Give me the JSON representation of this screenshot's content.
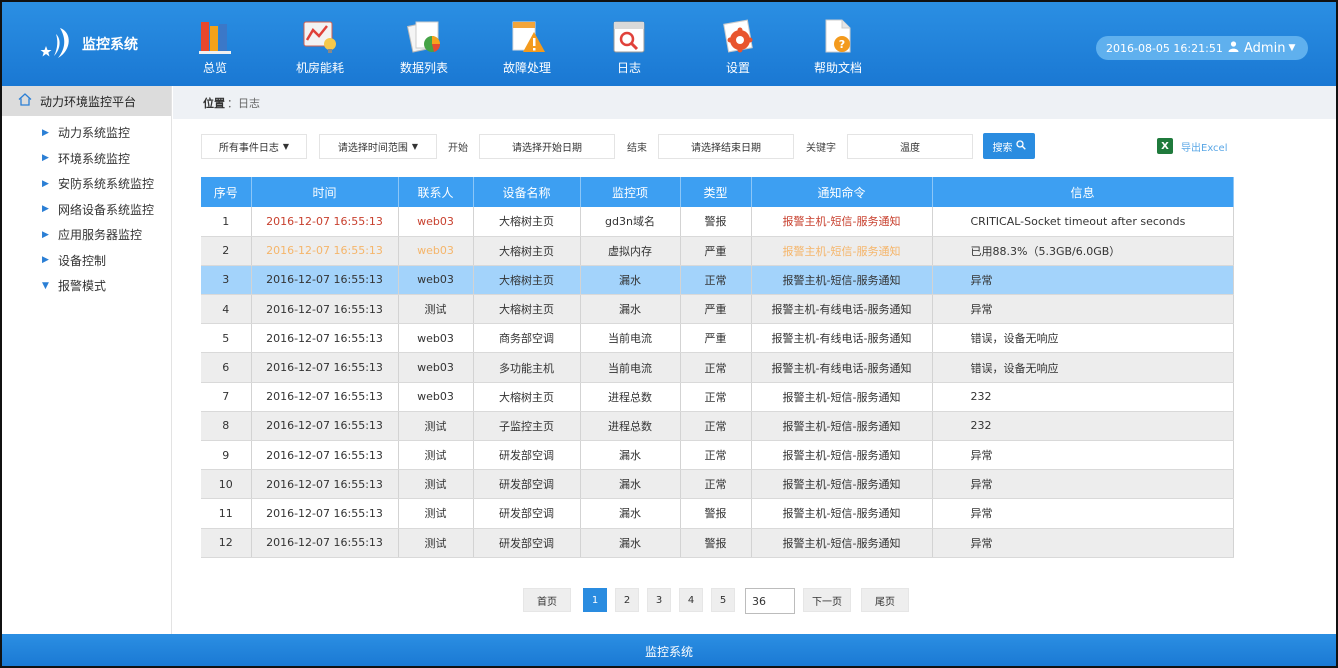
{
  "app": {
    "title": "监控系统"
  },
  "nav": [
    {
      "label": "总览",
      "icon": "books-icon"
    },
    {
      "label": "机房能耗",
      "icon": "energy-chart-icon"
    },
    {
      "label": "数据列表",
      "icon": "data-list-icon"
    },
    {
      "label": "故障处理",
      "icon": "warning-icon"
    },
    {
      "label": "日志",
      "icon": "log-calendar-icon"
    },
    {
      "label": "设置",
      "icon": "settings-gear-icon"
    },
    {
      "label": "帮助文档",
      "icon": "help-document-icon"
    }
  ],
  "header": {
    "datetime": "2016-08-05 16:21:51",
    "user": "Admin"
  },
  "sidebar": {
    "title": "动力环境监控平台",
    "items": [
      {
        "label": "动力系统监控",
        "expanded": false
      },
      {
        "label": "环境系统监控",
        "expanded": false
      },
      {
        "label": "安防系统系统监控",
        "expanded": false
      },
      {
        "label": "网络设备系统监控",
        "expanded": false
      },
      {
        "label": "应用服务器监控",
        "expanded": false
      },
      {
        "label": "设备控制",
        "expanded": false
      },
      {
        "label": "报警模式",
        "expanded": true
      }
    ]
  },
  "breadcrumb": {
    "prefix": "位置",
    "sep": "：",
    "current": "日志"
  },
  "filters": {
    "event_type": "所有事件日志",
    "time_range": "请选择时间范围",
    "start_label": "开始",
    "start_placeholder": "请选择开始日期",
    "end_label": "结束",
    "end_placeholder": "请选择结束日期",
    "keyword_label": "关键字",
    "keyword_value": "温度",
    "search_label": "搜索",
    "export_label": "导出Excel"
  },
  "table": {
    "columns": [
      "序号",
      "时间",
      "联系人",
      "设备名称",
      "监控项",
      "类型",
      "通知命令",
      "信息"
    ],
    "rows": [
      {
        "no": "1",
        "time": "2016-12-07 16:55:13",
        "contact": "web03",
        "device": "大榕树主页",
        "item": "gd3n域名",
        "type": "警报",
        "cmd": "报警主机-短信-服务通知",
        "info": "CRITICAL-Socket timeout after seconds",
        "tone": "red"
      },
      {
        "no": "2",
        "time": "2016-12-07 16:55:13",
        "contact": "web03",
        "device": "大榕树主页",
        "item": "虚拟内存",
        "type": "严重",
        "cmd": "报警主机-短信-服务通知",
        "info": "已用88.3%（5.3GB/6.0GB）",
        "tone": "orange"
      },
      {
        "no": "3",
        "time": "2016-12-07 16:55:13",
        "contact": "web03",
        "device": "大榕树主页",
        "item": "漏水",
        "type": "正常",
        "cmd": "报警主机-短信-服务通知",
        "info": "异常",
        "tone": "selected"
      },
      {
        "no": "4",
        "time": "2016-12-07 16:55:13",
        "contact": "测试",
        "device": "大榕树主页",
        "item": "漏水",
        "type": "严重",
        "cmd": "报警主机-有线电话-服务通知",
        "info": "异常",
        "tone": ""
      },
      {
        "no": "5",
        "time": "2016-12-07 16:55:13",
        "contact": "web03",
        "device": "商务部空调",
        "item": "当前电流",
        "type": "严重",
        "cmd": "报警主机-有线电话-服务通知",
        "info": "错误，设备无响应",
        "tone": ""
      },
      {
        "no": "6",
        "time": "2016-12-07 16:55:13",
        "contact": "web03",
        "device": "多功能主机",
        "item": "当前电流",
        "type": "正常",
        "cmd": "报警主机-有线电话-服务通知",
        "info": "错误，设备无响应",
        "tone": ""
      },
      {
        "no": "7",
        "time": "2016-12-07 16:55:13",
        "contact": "web03",
        "device": "大榕树主页",
        "item": "进程总数",
        "type": "正常",
        "cmd": "报警主机-短信-服务通知",
        "info": "232",
        "tone": ""
      },
      {
        "no": "8",
        "time": "2016-12-07 16:55:13",
        "contact": "测试",
        "device": "子监控主页",
        "item": "进程总数",
        "type": "正常",
        "cmd": "报警主机-短信-服务通知",
        "info": "232",
        "tone": ""
      },
      {
        "no": "9",
        "time": "2016-12-07 16:55:13",
        "contact": "测试",
        "device": "研发部空调",
        "item": "漏水",
        "type": "正常",
        "cmd": "报警主机-短信-服务通知",
        "info": "异常",
        "tone": ""
      },
      {
        "no": "10",
        "time": "2016-12-07 16:55:13",
        "contact": "测试",
        "device": "研发部空调",
        "item": "漏水",
        "type": "正常",
        "cmd": "报警主机-短信-服务通知",
        "info": "异常",
        "tone": ""
      },
      {
        "no": "11",
        "time": "2016-12-07 16:55:13",
        "contact": "测试",
        "device": "研发部空调",
        "item": "漏水",
        "type": "警报",
        "cmd": "报警主机-短信-服务通知",
        "info": "异常",
        "tone": ""
      },
      {
        "no": "12",
        "time": "2016-12-07 16:55:13",
        "contact": "测试",
        "device": "研发部空调",
        "item": "漏水",
        "type": "警报",
        "cmd": "报警主机-短信-服务通知",
        "info": "异常",
        "tone": ""
      }
    ]
  },
  "pagination": {
    "first": "首页",
    "pages": [
      "1",
      "2",
      "3",
      "4",
      "5"
    ],
    "current": "1",
    "input_value": "36",
    "next": "下一页",
    "last": "尾页"
  },
  "footer": {
    "text": "监控系统"
  },
  "colors": {
    "header": "#1e82d8",
    "table_header": "#3d9ff2",
    "selected_row": "#a3d3fb",
    "alert_red": "#c8402e",
    "alert_orange": "#f5b56a"
  }
}
